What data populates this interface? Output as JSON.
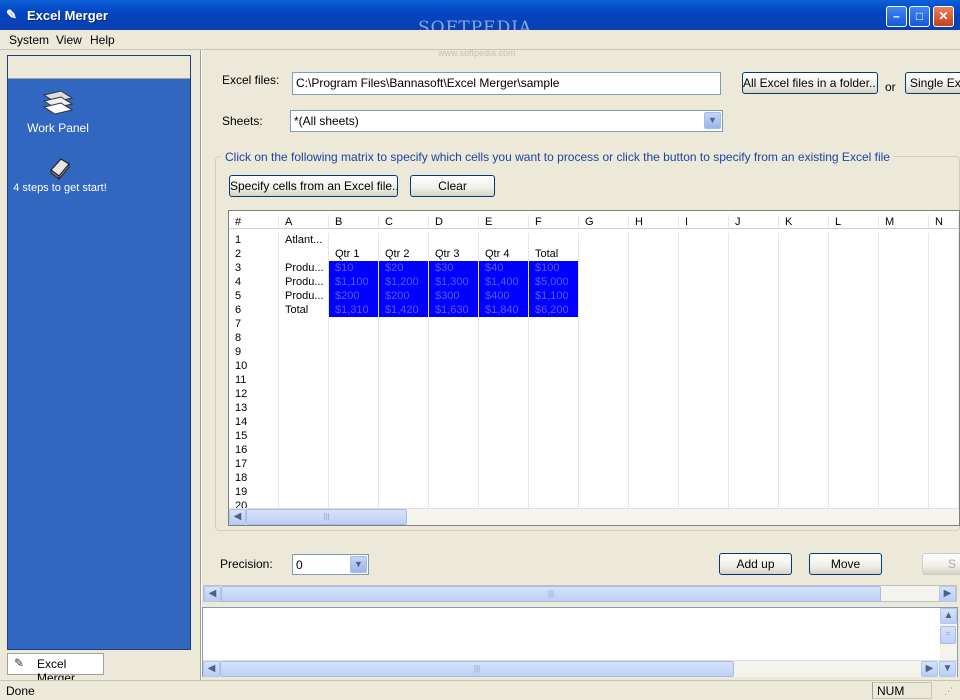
{
  "window": {
    "title": "Excel Merger",
    "watermark": "SOFTPEDIA",
    "watermark_url": "www.softpedia.com"
  },
  "menu": [
    "System",
    "View",
    "Help"
  ],
  "left_panel": {
    "items": [
      {
        "label": "Work Panel",
        "icon": "workpanel-icon"
      },
      {
        "label": "4 steps to get start!",
        "icon": "book-icon"
      }
    ],
    "tab_label": "Excel Merger"
  },
  "form": {
    "excel_files_label": "Excel files:",
    "excel_files_value": "C:\\Program Files\\Bannasoft\\Excel Merger\\sample",
    "all_files_button": "All Excel files in a folder...",
    "or_label": "or",
    "single_button": "Single Ex",
    "sheets_label": "Sheets:",
    "sheets_value": "*(All sheets)",
    "instruction": "Click on the following matrix to specify which cells you want to process or click the button to specify from an existing Excel file",
    "specify_button": "Specify cells from an Excel file...",
    "clear_button": "Clear",
    "precision_label": "Precision:",
    "precision_value": "0",
    "add_up_button": "Add up",
    "move_button": "Move",
    "cut_button": "S"
  },
  "grid": {
    "columns": [
      "#",
      "A",
      "B",
      "C",
      "D",
      "E",
      "F",
      "G",
      "H",
      "I",
      "J",
      "K",
      "L",
      "M",
      "N"
    ],
    "rows": [
      [
        "1",
        "Atlant...",
        "",
        "",
        "",
        "",
        ""
      ],
      [
        "2",
        "",
        "Qtr 1",
        "Qtr 2",
        "Qtr 3",
        "Qtr 4",
        "Total"
      ],
      [
        "3",
        "Produ...",
        "$10",
        "$20",
        "$30",
        "$40",
        "$100"
      ],
      [
        "4",
        "Produ...",
        "$1,100",
        "$1,200",
        "$1,300",
        "$1,400",
        "$5,000"
      ],
      [
        "5",
        "Produ...",
        "$200",
        "$200",
        "$300",
        "$400",
        "$1,100"
      ],
      [
        "6",
        "Total",
        "$1,310",
        "$1,420",
        "$1,630",
        "$1,840",
        "$6,200"
      ],
      [
        "7"
      ],
      [
        "8"
      ],
      [
        "9"
      ],
      [
        "10"
      ],
      [
        "11"
      ],
      [
        "12"
      ],
      [
        "13"
      ],
      [
        "14"
      ],
      [
        "15"
      ],
      [
        "16"
      ],
      [
        "17"
      ],
      [
        "18"
      ],
      [
        "19"
      ],
      [
        "20"
      ]
    ],
    "selection_color": "#0000ff"
  },
  "status": {
    "text": "Done",
    "num": "NUM"
  }
}
